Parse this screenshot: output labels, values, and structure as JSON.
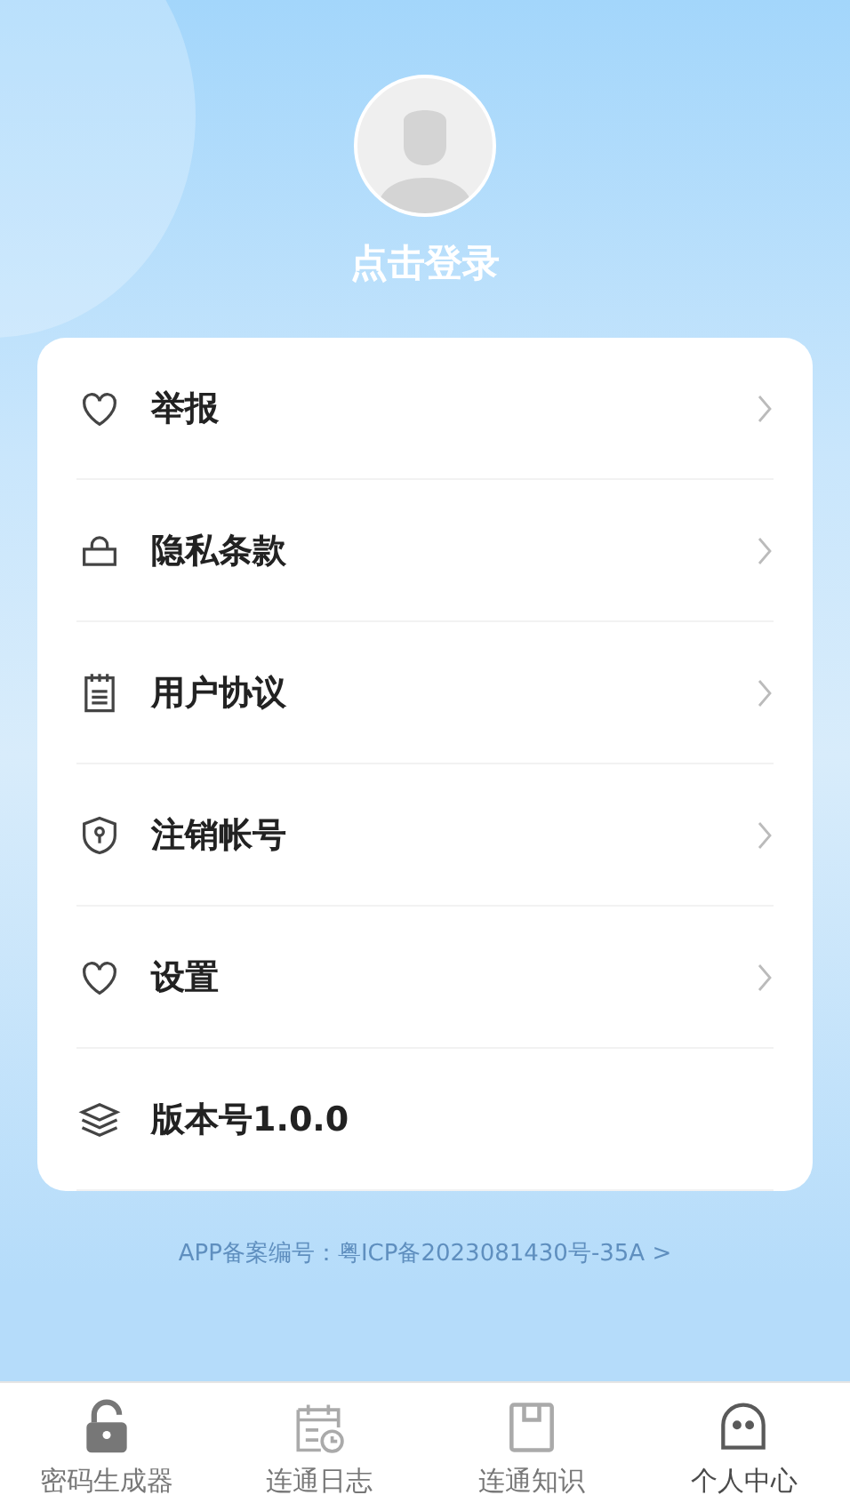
{
  "profile": {
    "login_label": "点击登录"
  },
  "menu": [
    {
      "kind": "heart",
      "label": "举报",
      "has_arrow": true
    },
    {
      "kind": "lock",
      "label": "隐私条款",
      "has_arrow": true
    },
    {
      "kind": "notepad",
      "label": "用户协议",
      "has_arrow": true
    },
    {
      "kind": "shield",
      "label": "注销帐号",
      "has_arrow": true
    },
    {
      "kind": "heart",
      "label": "设置",
      "has_arrow": true
    },
    {
      "kind": "layers",
      "label": "版本号1.0.0",
      "has_arrow": false
    }
  ],
  "icp": "APP备案编号：粤ICP备2023081430号-35A >",
  "tabs": [
    {
      "kind": "padlock",
      "label": "密码生成器",
      "selected": false
    },
    {
      "kind": "calendar",
      "label": "连通日志",
      "selected": false
    },
    {
      "kind": "box",
      "label": "连通知识",
      "selected": false
    },
    {
      "kind": "face",
      "label": "个人中心",
      "selected": true
    }
  ]
}
